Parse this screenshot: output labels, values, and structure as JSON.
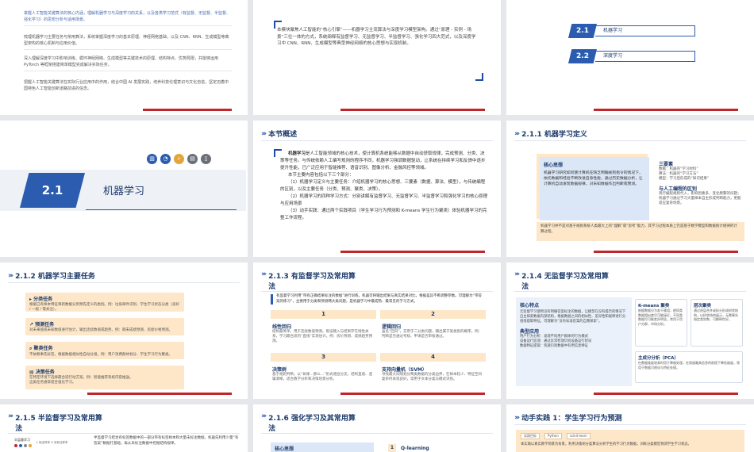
{
  "s1": {
    "items": [
      "掌握人工智能关键算法的核心内涵，理解机器学习与深度学习的关系，以及各类学习范式（有监督、无监督、半监督、强化学习）的思想分析与适用场景。",
      "梳理机器学习主要任务与常用算法，系统掌握深度学习的基本原理、神经网络基础，以及 CNN、RNN、生成模型等典型架构的核心机制与应用价值。",
      "深入理解深度学习中影响训练、循环神经网络、生成模型等关键技术的原理、结构特点、优势局限，并能够运用 PyTorch 等框架搭建简单模型完成解决实际任务。",
      "把握人工智能关键算法在实际行业应用中的作用，结合中国 AI 发展实践，培养科技伦理意识与文化自信，坚定迈着中国特色人工智能创新道路前进的信念。"
    ]
  },
  "s2": {
    "text": "本模块聚焦人工智能的“核心引擎”——机器学习主流算法与深度学习模型架构。通过“原理 - 实例 - 场景”三位一体的方式，系统阐释有监督学习、无监督学习、半监督学习、强化学习四大范式，以及深度学习中 CNN、RNN、生成模型等典型神经网络的核心思想与实现机制。"
  },
  "s3": {
    "items": [
      {
        "num": "2.1",
        "label": "机器学习"
      },
      {
        "num": "2.2",
        "label": "深度学习"
      }
    ]
  },
  "s4": {
    "num": "2.1",
    "title": "机器学习"
  },
  "s5": {
    "header": "本节概述",
    "title": "本节概述",
    "p1_bold": "机器学习",
    "p1": "是人工智能领域的核心技术，使计算机系统能够从数据中自动获取规律，完成预测、分类、决策等任务。与传统依赖人工编写规则的程序不同，机器学习强调数据驱动，让系统在持续学习和反馈中逐步提升性能，已广泛应用于智能推荐、语音识别、图像分析、金融风控等领域。",
    "p2": "本节主要内容包括以下三个部分：",
    "l1": "（1）机器学习定义与主要任务：介绍机器学习的核心思想、三要素（数据、算法、模型），与传统编程的区别，以及主要任务（分类、预测、聚类、决策）。",
    "l2": "（2）机器学习的四种学习方式：分别讲解有监督学习、无监督学习、半监督学习和强化学习的核心原理与应用场景",
    "l3": "（3）动手实践：通过两个实践项目（学生学习行为预测和 K-means 学生行为聚类）体验机器学习的完整工作流程。"
  },
  "s6": {
    "header": "2.1.1  机器学习定义",
    "core_title": "核心思想",
    "core_text": "机器学习研究如何使计算机在缺乏明确规则指令的情况下，依托数据和经验不断改进自身性能，通过历史数据分析，让计算机自动发现数据规律，对未知数据作出判断或预测。",
    "three_title": "三要素",
    "three_items": [
      "数据：机器的“学习材料”",
      "算法：机器的“学习方法”",
      "模型：学习后形成的“知识结果”"
    ],
    "rel_title": "与人工编程的区别",
    "rel_text": "现行编程规则代入，影响因素多，变化频繁的问题；机器学习通过学习大量样本自主形成判断能力，更能适应复杂场景。",
    "bottom": "机器学习并不是对基于规则系统人类最大上的“理解”或“思考”能力，其学习过程本质上仍是基于数学模型和数据统计规律的计算过程。"
  },
  "s7": {
    "header": "2.1.2  机器学习主要任务",
    "cards": [
      {
        "title": "分类任务",
        "desc": "根据已有样本特征将新数据分到预先定义的类别。例：垃圾邮件识别、学生学习状态分类（良好 / 一般 / 需关注）。"
      },
      {
        "title": "预测任务",
        "desc": "对未来值或未知数值进行估计，输出连续数值或趋势。例：期末成绩预测、房屋价格预测。"
      },
      {
        "title": "聚类任务",
        "desc": "不依赖事先标签，根据数据相似性自动分组。例：用户消费群体划分、学生学习行为聚类。"
      },
      {
        "title": "决策任务",
        "desc": "在特定环境下选择最合适行动方案。例：智能推荐系统内容推送。"
      }
    ],
    "extra": "这类任务通常结合强化学习。"
  },
  "s8": {
    "header_l1": "2.1.3  有监督学习及常用算",
    "header_l2": "法",
    "intro": "有监督学习利用“带有正确结果标注的数据”进行训练，机器可将输出结果与真实结果对比，根据差异不断调整参数。可理解为“带答案的练习”，主要用于分类和预测两大类问题，是机器学习中最成熟、最常见的学习方式。",
    "cells": [
      {
        "num": "1",
        "title": "线性回归",
        "desc": "结构最简单，用于连续数值预测。假设输入与结果存在线性关系，学习最合适的“直线”实现估计。例：房价预测、成绩趋势预测。"
      },
      {
        "num": "2",
        "title": "逻辑回归",
        "desc": "虽名“回归”，实用于二分类问题，输出属于某类别的概率。例：判断是否通过考核、申请是否审核通过。"
      },
      {
        "num": "3",
        "title": "决策树",
        "desc": "基于规则判断，以“如果…那么…”形式逐层分支，结构直观、逻辑清晰，适合教学分析和决策场景分析。"
      },
      {
        "num": "4",
        "title": "支持向量机（SVM）",
        "desc": "寻找最大间隔划分两类数据的分类边界，在样本较少、特征空间复杂时表现良好，常用于文本分类与模式识别。"
      }
    ]
  },
  "s9": {
    "header_l1": "2.1.4  无监督学习及常用算",
    "header_l2": "法",
    "core_title": "核心特点",
    "core_text": "无监督学习使用没有明确答案标注的数据，让模型在没有提示的情况下自主探索数据内部结构，根据数据之间的相似性、差异性和规律进行分组或提取特征。可理解为“没有标准答案的自我探索”。",
    "app_title": "典型应用",
    "apps": [
      "用户行为分析：发现不同用户群体的行为模式",
      "设备运行监测：通过异常检测识别设备运行状况",
      "数据特征提取：快速识别数据中有用信息特征"
    ],
    "km_title": "K-means 聚类",
    "km_text": "根据数据分为若干簇组，使同类数据相似度尽可能接近，不同类数据尽可能差异明显。常用于用户分群、市场分析。",
    "hc_title": "层次聚类",
    "hc_text": "通过逐层合并或拆分形成树状结构，以树状结构展示，无需事先指定类别数，可解释性好。",
    "pca_title": "主成分分析（PCA）",
    "pca_text": "在数据维度较高时用于降维处理，在保留最具信息的前提下降低维度，常用于数据可视化与特征处理。"
  },
  "s10": {
    "header_l1": "2.1.5  半监督学习及常用算",
    "header_l2": "法",
    "fig_label": "半监督学习",
    "fig_caption": "L 标注样本 U 无标注样本",
    "text": "半监督学习结合有标签数据中的一部分带有标签样本和大量未标注数据，机器先利用少量“有答案”数据打基础，再从未标注数据中挖掘结构规律。"
  },
  "s11": {
    "header_l1": "2.1.6  强化学习及其常用算",
    "header_l2": "法",
    "core_title": "核心思想",
    "algo_num": "1",
    "algo_title": "Q-learning"
  },
  "s12": {
    "header": "动手实践 1：学生学习行为预测",
    "tags": [
      "实践目标",
      "Python",
      "scikit-learn"
    ],
    "text": "本实践以真实教学场景为背景，利用决策树分类算法分析学生的学习行为数据，训练分类模型预测学生学习状态。"
  }
}
